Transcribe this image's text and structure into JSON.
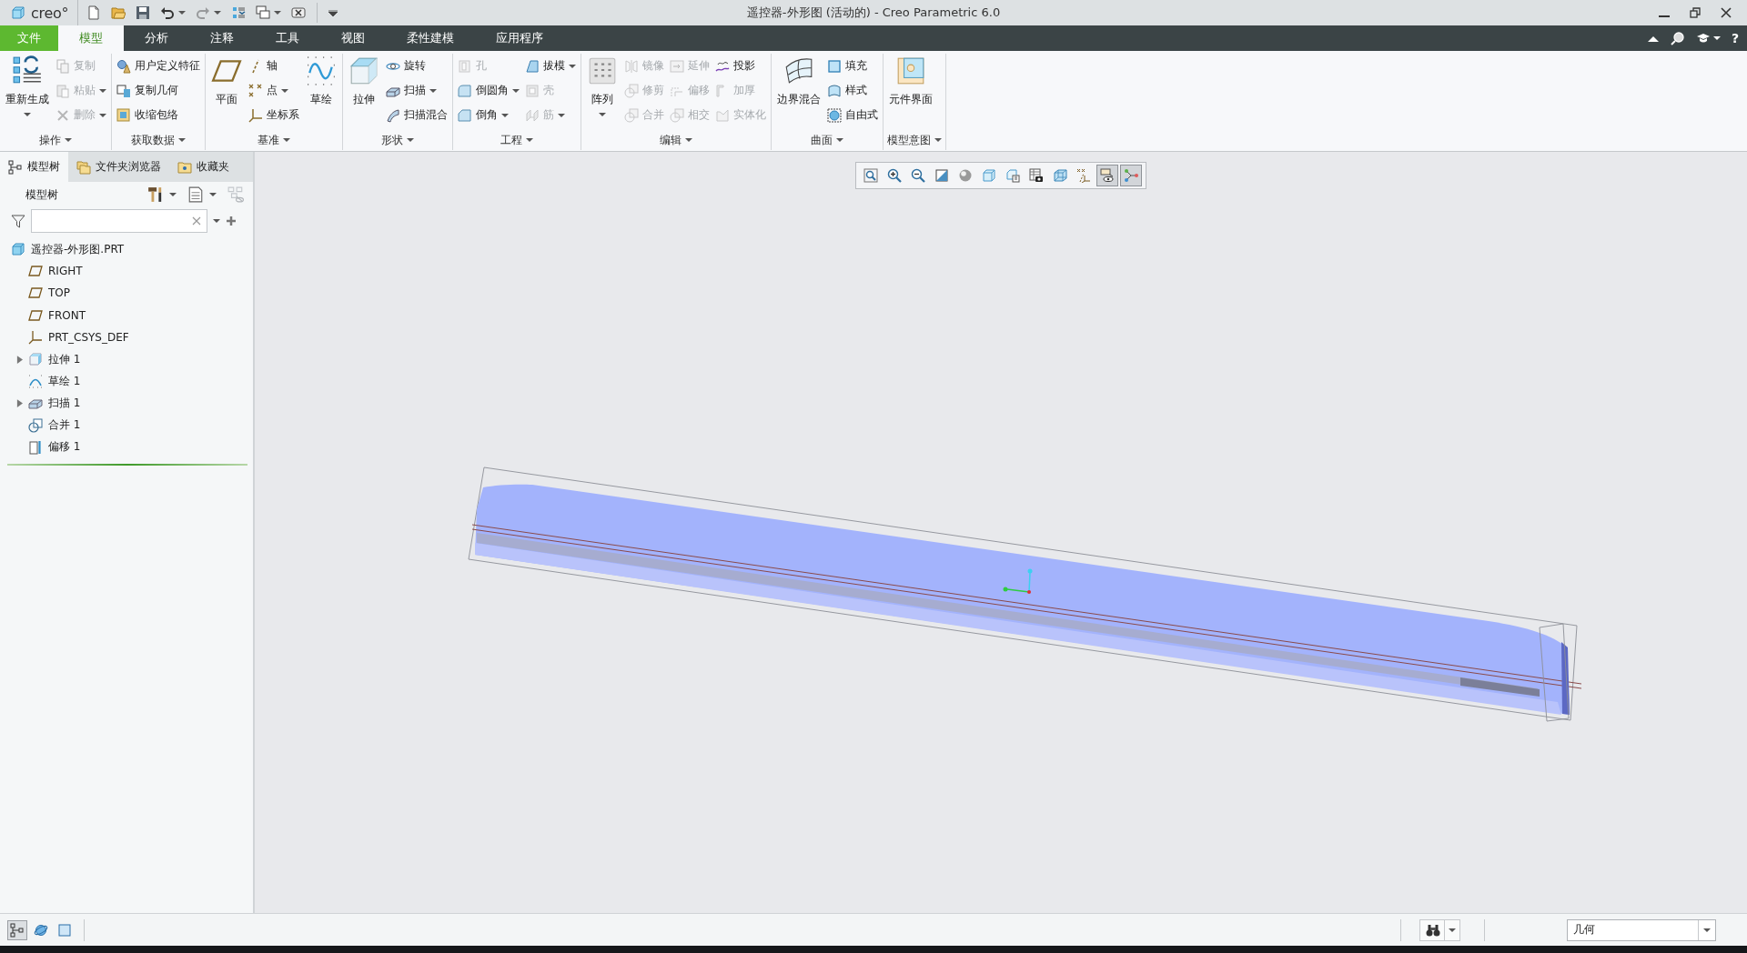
{
  "window": {
    "logo": "creo°",
    "title": "遥控器-外形图 (活动的) - Creo Parametric 6.0"
  },
  "quick_access": [
    {
      "menu": false,
      "disabled": false
    },
    {
      "menu": false,
      "disabled": false
    },
    {
      "menu": false,
      "disabled": false
    },
    {
      "menu": true,
      "disabled": false
    },
    {
      "menu": true,
      "disabled": true
    },
    {
      "menu": false,
      "disabled": false
    },
    {
      "menu": true,
      "disabled": false
    },
    {
      "menu": false,
      "disabled": false
    }
  ],
  "ribbon_tabs": [
    {
      "label": "文件",
      "kind": "file",
      "selected": false
    },
    {
      "label": "模型",
      "kind": "tab",
      "selected": true
    },
    {
      "label": "分析",
      "kind": "tab",
      "selected": false
    },
    {
      "label": "注释",
      "kind": "tab",
      "selected": false
    },
    {
      "label": "工具",
      "kind": "tab",
      "selected": false
    },
    {
      "label": "视图",
      "kind": "tab",
      "selected": false
    },
    {
      "label": "柔性建模",
      "kind": "tab",
      "selected": false
    },
    {
      "label": "应用程序",
      "kind": "tab",
      "selected": false
    }
  ],
  "help_button": "?",
  "ribbon_groups": [
    {
      "label": "操作",
      "columns": [
        {
          "items": [
            {
              "kind": "large",
              "label": "重新生成",
              "menu": true,
              "disabled": false
            }
          ]
        },
        {
          "items": [
            {
              "kind": "small",
              "label": "复制",
              "menu": false,
              "disabled": true
            },
            {
              "kind": "small",
              "label": "粘贴",
              "menu": true,
              "disabled": true
            },
            {
              "kind": "small",
              "label": "删除",
              "menu": true,
              "disabled": true
            }
          ]
        }
      ]
    },
    {
      "label": "获取数据",
      "columns": [
        {
          "items": [
            {
              "kind": "small",
              "label": "用户定义特征",
              "menu": false,
              "disabled": false
            },
            {
              "kind": "small",
              "label": "复制几何",
              "menu": false,
              "disabled": false
            },
            {
              "kind": "small",
              "label": "收缩包络",
              "menu": false,
              "disabled": false
            }
          ]
        }
      ]
    },
    {
      "label": "基准",
      "columns": [
        {
          "items": [
            {
              "kind": "large",
              "label": "平面",
              "menu": false,
              "disabled": false
            }
          ]
        },
        {
          "items": [
            {
              "kind": "small",
              "label": "轴",
              "menu": false,
              "disabled": false
            },
            {
              "kind": "small",
              "label": "点",
              "menu": true,
              "disabled": false
            },
            {
              "kind": "small",
              "label": "坐标系",
              "menu": false,
              "disabled": false
            }
          ]
        },
        {
          "items": [
            {
              "kind": "large",
              "label": "草绘",
              "menu": false,
              "disabled": false
            }
          ]
        }
      ]
    },
    {
      "label": "形状",
      "columns": [
        {
          "items": [
            {
              "kind": "large",
              "label": "拉伸",
              "menu": false,
              "disabled": false
            }
          ]
        },
        {
          "items": [
            {
              "kind": "small",
              "label": "旋转",
              "menu": false,
              "disabled": false
            },
            {
              "kind": "small",
              "label": "扫描",
              "menu": true,
              "disabled": false
            },
            {
              "kind": "small",
              "label": "扫描混合",
              "menu": false,
              "disabled": false
            }
          ]
        }
      ]
    },
    {
      "label": "工程",
      "columns": [
        {
          "items": [
            {
              "kind": "small",
              "label": "孔",
              "menu": false,
              "disabled": true
            },
            {
              "kind": "small",
              "label": "倒圆角",
              "menu": true,
              "disabled": false
            },
            {
              "kind": "small",
              "label": "倒角",
              "menu": true,
              "disabled": false
            }
          ]
        },
        {
          "items": [
            {
              "kind": "small",
              "label": "拔模",
              "menu": true,
              "disabled": false
            },
            {
              "kind": "small",
              "label": "壳",
              "menu": false,
              "disabled": true
            },
            {
              "kind": "small",
              "label": "筋",
              "menu": true,
              "disabled": true
            }
          ]
        }
      ]
    },
    {
      "label": "编辑",
      "columns": [
        {
          "items": [
            {
              "kind": "large",
              "label": "阵列",
              "menu": true,
              "disabled": false
            }
          ]
        },
        {
          "items": [
            {
              "kind": "small",
              "label": "镜像",
              "menu": false,
              "disabled": true
            },
            {
              "kind": "small",
              "label": "修剪",
              "menu": false,
              "disabled": true
            },
            {
              "kind": "small",
              "label": "合并",
              "menu": false,
              "disabled": true
            }
          ]
        },
        {
          "items": [
            {
              "kind": "small",
              "label": "延伸",
              "menu": false,
              "disabled": true
            },
            {
              "kind": "small",
              "label": "偏移",
              "menu": false,
              "disabled": true
            },
            {
              "kind": "small",
              "label": "相交",
              "menu": false,
              "disabled": true
            }
          ]
        },
        {
          "items": [
            {
              "kind": "small",
              "label": "投影",
              "menu": false,
              "disabled": false
            },
            {
              "kind": "small",
              "label": "加厚",
              "menu": false,
              "disabled": true
            },
            {
              "kind": "small",
              "label": "实体化",
              "menu": false,
              "disabled": true
            }
          ]
        }
      ]
    },
    {
      "label": "曲面",
      "columns": [
        {
          "items": [
            {
              "kind": "large",
              "label": "边界混合",
              "menu": false,
              "disabled": false
            }
          ]
        },
        {
          "items": [
            {
              "kind": "small",
              "label": "填充",
              "menu": false,
              "disabled": false
            },
            {
              "kind": "small",
              "label": "样式",
              "menu": false,
              "disabled": false
            },
            {
              "kind": "small",
              "label": "自由式",
              "menu": false,
              "disabled": false
            }
          ]
        }
      ]
    },
    {
      "label": "模型意图",
      "columns": [
        {
          "items": [
            {
              "kind": "large",
              "label": "元件界面",
              "menu": false,
              "disabled": false
            }
          ]
        }
      ]
    }
  ],
  "navigator": {
    "tabs": [
      {
        "label": "模型树",
        "selected": true
      },
      {
        "label": "文件夹浏览器",
        "selected": false
      },
      {
        "label": "收藏夹",
        "selected": false
      }
    ],
    "title": "模型树",
    "tree": [
      {
        "label": "遥控器-外形图.PRT",
        "kind": "part",
        "children": [
          {
            "label": "RIGHT",
            "kind": "datum_plane"
          },
          {
            "label": "TOP",
            "kind": "datum_plane"
          },
          {
            "label": "FRONT",
            "kind": "datum_plane"
          },
          {
            "label": "PRT_CSYS_DEF",
            "kind": "csys"
          },
          {
            "label": "拉伸 1",
            "kind": "extrude",
            "expanded": false
          },
          {
            "label": "草绘 1",
            "kind": "sketch"
          },
          {
            "label": "扫描 1",
            "kind": "sweep",
            "expanded": false
          },
          {
            "label": "合并 1",
            "kind": "merge"
          },
          {
            "label": "偏移 1",
            "kind": "offset"
          }
        ]
      }
    ]
  },
  "view_toolbar": [
    {
      "on": false
    },
    {
      "on": false
    },
    {
      "on": false
    },
    {
      "on": false
    },
    {
      "on": false
    },
    {
      "on": false
    },
    {
      "on": false
    },
    {
      "on": false
    },
    {
      "on": false
    },
    {
      "on": false
    },
    {
      "on": true
    },
    {
      "on": true
    }
  ],
  "status_bar": {
    "toggles": [
      {
        "on": true
      },
      {
        "on": false
      },
      {
        "on": false
      }
    ],
    "selection_filter": "几何"
  }
}
